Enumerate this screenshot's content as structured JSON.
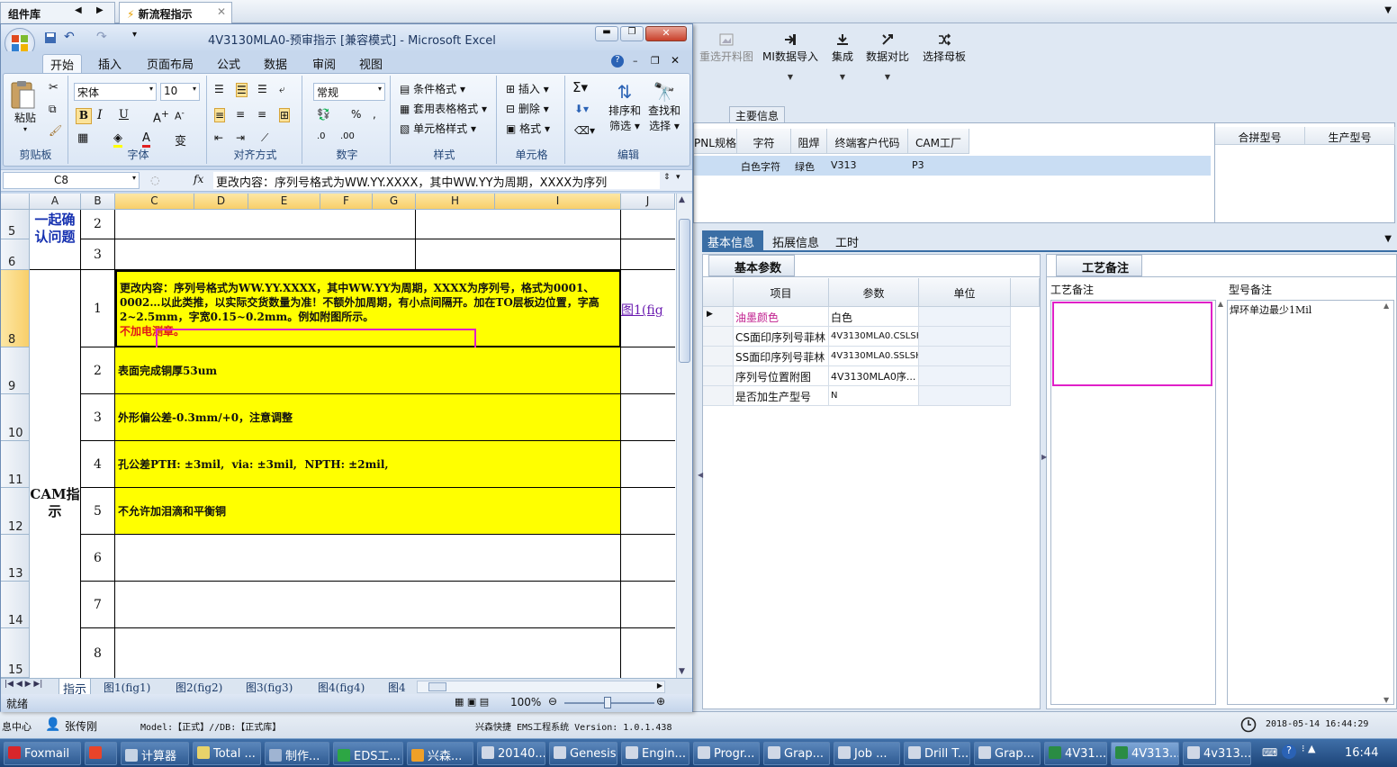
{
  "host": {
    "tabs": [
      {
        "label": "组件库"
      },
      {
        "label": "新流程指示"
      }
    ],
    "ribbon": [
      "重选开料图",
      "MI数据导入",
      "集成",
      "数据对比",
      "选择母板"
    ],
    "main_info_tab": "主要信息",
    "main_grid": {
      "headers": [
        "PNL规格",
        "字符",
        "阻焊",
        "终端客户代码",
        "CAM工厂"
      ],
      "row": [
        "白色字符",
        "绿色",
        "V313",
        "P3"
      ],
      "right_headers": [
        "合拼型号",
        "生产型号"
      ]
    },
    "tabs2": [
      "基本信息",
      "拓展信息",
      "工时"
    ],
    "basic_params": {
      "title": "基本参数",
      "headers": [
        "项目",
        "参数",
        "单位"
      ],
      "rows": [
        {
          "item": "油墨颜色",
          "value": "白色"
        },
        {
          "item": "CS面印序列号菲林",
          "value": "4V3130MLA0.CSLSH"
        },
        {
          "item": "SS面印序列号菲林",
          "value": "4V3130MLA0.SSLSH"
        },
        {
          "item": "序列号位置附图",
          "value": "4V3130MLA0序..."
        },
        {
          "item": "是否加生产型号",
          "value": "N"
        }
      ]
    },
    "process_note": {
      "title": "工艺备注",
      "col1": "工艺备注",
      "col2": "型号备注",
      "model_note": "焊环单边最少1Mil"
    },
    "status": {
      "left": "息中心",
      "user": "张传刚",
      "model": "Model:【正式】//DB:【正式库】",
      "system": "兴森快捷 EMS工程系统 Version: 1.0.1.438",
      "datetime": "2018-05-14 16:44:29"
    }
  },
  "excel": {
    "title": "4V3130MLA0-预审指示 [兼容模式] - Microsoft Excel",
    "tabs": [
      "开始",
      "插入",
      "页面布局",
      "公式",
      "数据",
      "审阅",
      "视图"
    ],
    "groups": {
      "clipboard": "剪贴板",
      "font": "字体",
      "align": "对齐方式",
      "number": "数字",
      "styles": "样式",
      "cells": "单元格",
      "edit": "编辑"
    },
    "paste": "粘贴",
    "font_name": "宋体",
    "font_size": "10",
    "number_format": "常规",
    "style_items": [
      "条件格式",
      "套用表格格式",
      "单元格样式"
    ],
    "cell_items": [
      "插入",
      "删除",
      "格式"
    ],
    "sort_label": [
      "排序和",
      "筛选"
    ],
    "find_label": [
      "查找和",
      "选择"
    ],
    "name_box": "C8",
    "formula": "更改内容：序列号格式为WW.YY.XXXX，其中WW.YY为周期，XXXX为序列",
    "columns": [
      "A",
      "B",
      "C",
      "D",
      "E",
      "F",
      "G",
      "H",
      "I",
      "J"
    ],
    "rows": [
      {
        "num": "5",
        "b": "2",
        "c": ""
      },
      {
        "num": "6",
        "b": "3",
        "c": ""
      },
      {
        "num": "8",
        "b": "1",
        "c": "更改内容：序列号格式为WW.YY.XXXX，其中WW.YY为周期，XXXX为序列号，格式为0001、0002…以此类推，以实际交货数量为准！不额外加周期，有小点间隔开。加在TO层板边位置，字高2~2.5mm，字宽0.15~0.2mm。例如附图所示。",
        "c_red": "不加电测章。",
        "j": "图1(fig"
      },
      {
        "num": "9",
        "b": "2",
        "c": "表面完成铜厚53um"
      },
      {
        "num": "10",
        "b": "3",
        "c": "外形偏公差-0.3mm/+0，注意调整"
      },
      {
        "num": "11",
        "b": "4",
        "c": "孔公差PTH: ±3mil,  via: ±3mil,  NPTH: ±2mil,"
      },
      {
        "num": "12",
        "b": "5",
        "c": "不允许加泪滴和平衡铜"
      },
      {
        "num": "13",
        "b": "6",
        "c": ""
      },
      {
        "num": "14",
        "b": "7",
        "c": ""
      },
      {
        "num": "15",
        "b": "8",
        "c": ""
      }
    ],
    "a_labels": {
      "top": "一起确认问题",
      "cam": "CAM指示"
    },
    "sheet_tabs": [
      "指示",
      "图1(fig1)",
      "图2(fig2)",
      "图3(fig3)",
      "图4(fig4)",
      "图4"
    ],
    "status_ready": "就绪",
    "zoom": "100%"
  },
  "taskbar": {
    "items": [
      "Foxmail",
      "",
      "计算器",
      "Total ...",
      "制作...",
      "EDS工...",
      "兴森...",
      "20140...",
      "Genesis",
      "Engin...",
      "Progr...",
      "Grap...",
      "Job ...",
      "Drill T...",
      "Grap...",
      "4V31...",
      "4V313...",
      "4v313..."
    ],
    "clock": "16:44"
  }
}
